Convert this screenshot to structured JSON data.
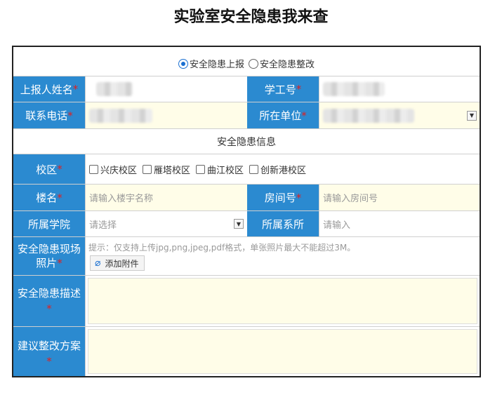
{
  "title": "实验室安全隐患我来查",
  "report_type": {
    "options": [
      "安全隐患上报",
      "安全隐患整改"
    ],
    "selected": "安全隐患上报"
  },
  "fields": {
    "reporter_name": {
      "label": "上报人姓名",
      "required": "*"
    },
    "student_id": {
      "label": "学工号",
      "required": "*"
    },
    "phone": {
      "label": "联系电话",
      "required": "*"
    },
    "unit": {
      "label": "所在单位",
      "required": "*"
    },
    "campus": {
      "label": "校区",
      "required": "*",
      "options": [
        "兴庆校区",
        "雁塔校区",
        "曲江校区",
        "创新港校区"
      ]
    },
    "building": {
      "label": "楼名",
      "required": "*",
      "placeholder": "请输入楼宇名称"
    },
    "room": {
      "label": "房间号",
      "required": "*",
      "placeholder": "请输入房间号"
    },
    "college": {
      "label": "所属学院",
      "placeholder": "请选择"
    },
    "department": {
      "label": "所属系所",
      "placeholder": "请输入"
    },
    "photo": {
      "label": "安全隐患现场照片",
      "required": "*",
      "hint": "提示：仅支持上传jpg,png,jpeg,pdf格式，单张照片最大不能超过3M。",
      "attach_label": "添加附件"
    },
    "description": {
      "label": "安全隐患描述",
      "required": "*"
    },
    "suggestion": {
      "label": "建议整改方案",
      "required": "*"
    }
  },
  "section_info": "安全隐患信息",
  "colors": {
    "label_bg": "#2b8ad0",
    "input_yellow": "#fffde8",
    "required": "#e02020"
  },
  "icons": {
    "dropdown": "chevron-down-icon",
    "attach": "paperclip-icon"
  }
}
